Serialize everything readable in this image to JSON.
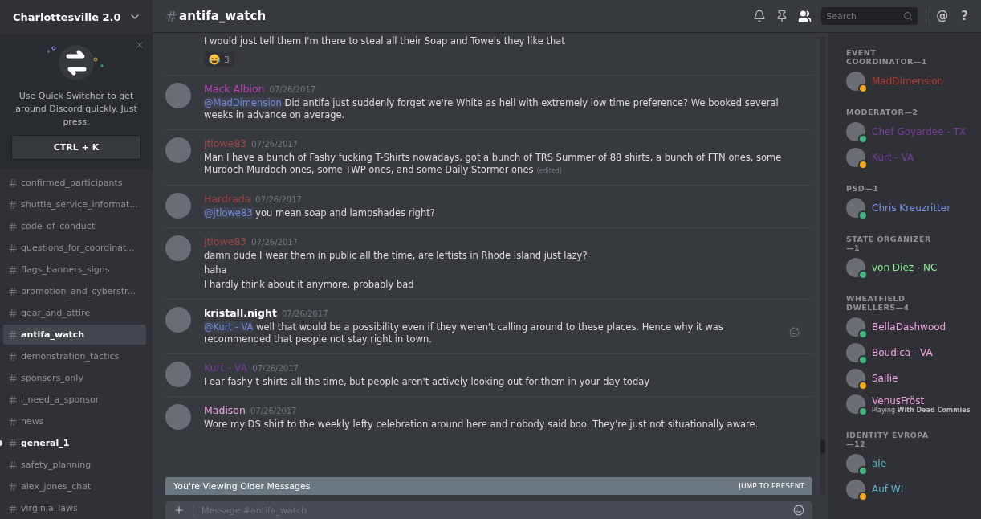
{
  "server": {
    "name": "Charlottesville 2.0"
  },
  "quick_switcher": {
    "text": "Use Quick Switcher to get around Discord quickly. Just press:",
    "shortcut": "CTRL + K"
  },
  "channels": [
    {
      "name": "confirmed_participants",
      "selected": false,
      "unread": false
    },
    {
      "name": "shuttle_service_informat...",
      "selected": false,
      "unread": false
    },
    {
      "name": "code_of_conduct",
      "selected": false,
      "unread": false
    },
    {
      "name": "questions_for_coordinat...",
      "selected": false,
      "unread": false
    },
    {
      "name": "flags_banners_signs",
      "selected": false,
      "unread": false
    },
    {
      "name": "promotion_and_cyberstr...",
      "selected": false,
      "unread": false
    },
    {
      "name": "gear_and_attire",
      "selected": false,
      "unread": false
    },
    {
      "name": "antifa_watch",
      "selected": true,
      "unread": false
    },
    {
      "name": "demonstration_tactics",
      "selected": false,
      "unread": false
    },
    {
      "name": "sponsors_only",
      "selected": false,
      "unread": false
    },
    {
      "name": "i_need_a_sponsor",
      "selected": false,
      "unread": false
    },
    {
      "name": "news",
      "selected": false,
      "unread": false
    },
    {
      "name": "general_1",
      "selected": false,
      "unread": true
    },
    {
      "name": "safety_planning",
      "selected": false,
      "unread": false
    },
    {
      "name": "alex_jones_chat",
      "selected": false,
      "unread": false
    },
    {
      "name": "virginia_laws",
      "selected": false,
      "unread": false
    }
  ],
  "channel_header": {
    "hash": "#",
    "name": "antifa_watch"
  },
  "search": {
    "placeholder": "Search"
  },
  "header_buttons": [
    "@",
    "?"
  ],
  "messages": [
    {
      "lines": [
        {
          "text": "I would just tell them I'm there to steal all their Soap and Towels they like that"
        }
      ],
      "reactions": [
        {
          "count": "3"
        }
      ]
    },
    {
      "author": "Mack Albion",
      "color": "#c03fbd",
      "time": "07/26/2017",
      "lines": [
        {
          "mention": "@MadDimension",
          "text": " Did antifa just suddenly forget we're White as hell with extremely low time preference? We booked several weeks in advance on average."
        }
      ]
    },
    {
      "author": "jtlowe83",
      "color": "#a04444",
      "time": "07/26/2017",
      "lines": [
        {
          "text": "Man I have a bunch of Fashy fucking T-Shirts nowadays, got a bunch of TRS Summer of 88 shirts, a bunch of FTN ones, some Murdoch Murdoch ones, some TWP ones, and some Daily Stormer ones",
          "edited": "(edited)"
        }
      ]
    },
    {
      "author": "Hardrada",
      "color": "#9c4040",
      "time": "07/26/2017",
      "lines": [
        {
          "mention": "@jtlowe83",
          "text": " you mean soap and lampshades right?"
        }
      ]
    },
    {
      "author": "jtlowe83",
      "color": "#a04444",
      "time": "07/26/2017",
      "lines": [
        {
          "text": "damn dude I wear them in public all the time, are leftists in Rhode Island just lazy?"
        },
        {
          "text": "haha"
        },
        {
          "text": "I hardly think about it anymore, probably bad"
        }
      ]
    },
    {
      "author": "kristall.night",
      "color": "#ffffff",
      "time": "07/26/2017",
      "hover": true,
      "lines": [
        {
          "mention": "@Kurt - VA",
          "text": " well that would be a possibility even if they weren't calling around to these places. Hence why it was recommended that people not stay right in town."
        }
      ]
    },
    {
      "author": "Kurt - VA",
      "color": "#7a3d9c",
      "time": "07/26/2017",
      "lines": [
        {
          "text": "I ear fashy t-shirts all the time, but people aren't actively looking out for them in your day-today"
        }
      ]
    },
    {
      "author": "Madison",
      "color": "#f0a3dc",
      "time": "07/26/2017",
      "lines": [
        {
          "text": "Wore my DS shirt to the weekly lefty celebration around here and nobody said boo. They're just not situationally aware."
        }
      ]
    }
  ],
  "banner": {
    "text": "You're Viewing Older Messages",
    "action": "JUMP TO PRESENT"
  },
  "composer": {
    "placeholder": "Message #antifa_watch"
  },
  "member_groups": [
    {
      "title": "EVENT COORDINATOR—1",
      "members": [
        {
          "name": "MadDimension",
          "color": "#b8392e",
          "idle": true
        }
      ]
    },
    {
      "title": "MODERATOR—2",
      "members": [
        {
          "name": "Chef Goyardee - TX",
          "color": "#7a3d9c",
          "idle": false
        },
        {
          "name": "Kurt - VA",
          "color": "#7a3d9c",
          "idle": true
        }
      ]
    },
    {
      "title": "PSD—1",
      "members": [
        {
          "name": "Chris Kreuzritter",
          "color": "#7a93f0",
          "idle": false
        }
      ]
    },
    {
      "title": "STATE ORGANIZER—1",
      "members": [
        {
          "name": "von Diez - NC",
          "color": "#86f08a",
          "idle": false
        }
      ]
    },
    {
      "title": "WHEATFIELD DWELLERS—4",
      "members": [
        {
          "name": "BellaDashwood",
          "color": "#f0a3dc",
          "idle": false
        },
        {
          "name": "Boudica - VA",
          "color": "#f0a3dc",
          "idle": false
        },
        {
          "name": "Sallie",
          "color": "#f0a3dc",
          "idle": true
        },
        {
          "name": "VenusFröst",
          "color": "#f0a3dc",
          "idle": false,
          "activity": "Playing **With Dead Commies**"
        }
      ]
    },
    {
      "title": "IDENTITY EVROPA—12",
      "members": [
        {
          "name": "ale",
          "color": "#5fb8c4",
          "idle": false
        },
        {
          "name": "Auf WI",
          "color": "#5fb8c4",
          "idle": true
        }
      ]
    }
  ]
}
